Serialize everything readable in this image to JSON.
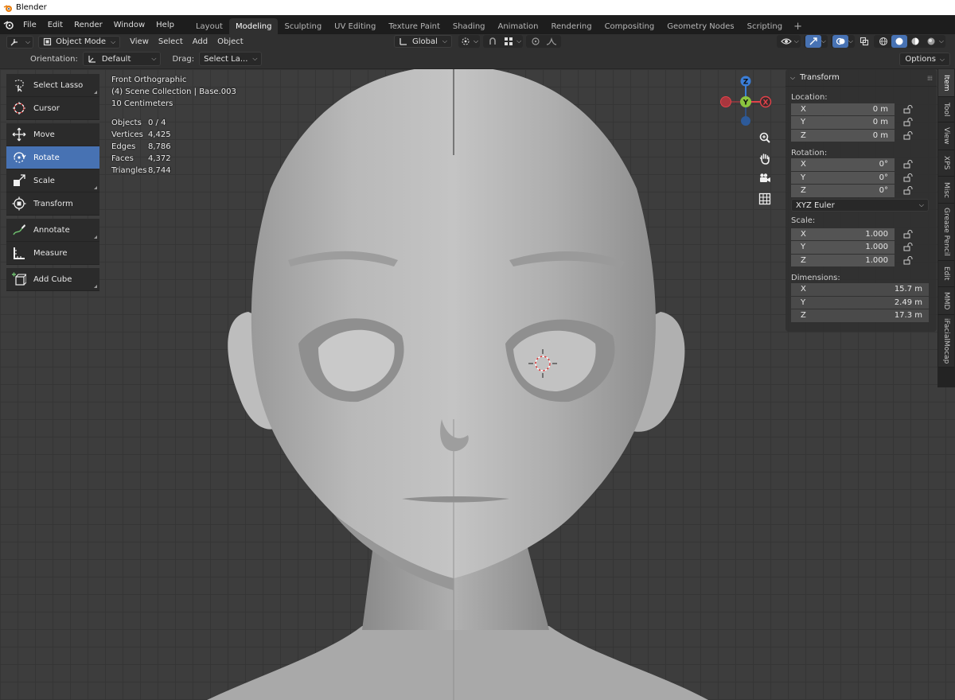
{
  "window": {
    "title": "Blender"
  },
  "menu": [
    "File",
    "Edit",
    "Render",
    "Window",
    "Help"
  ],
  "workspaces": [
    "Layout",
    "Modeling",
    "Sculpting",
    "UV Editing",
    "Texture Paint",
    "Shading",
    "Animation",
    "Rendering",
    "Compositing",
    "Geometry Nodes",
    "Scripting"
  ],
  "active_workspace": "Modeling",
  "header": {
    "mode": "Object Mode",
    "menus": [
      "View",
      "Select",
      "Add",
      "Object"
    ],
    "transform_orientation": "Global"
  },
  "tool_settings": {
    "orientation_label": "Orientation:",
    "orientation_value": "Default",
    "drag_label": "Drag:",
    "drag_value": "Select La...",
    "options_label": "Options"
  },
  "tools": {
    "select_lasso": "Select Lasso",
    "cursor": "Cursor",
    "move": "Move",
    "rotate": "Rotate",
    "scale": "Scale",
    "transform": "Transform",
    "annotate": "Annotate",
    "measure": "Measure",
    "add_cube": "Add Cube"
  },
  "overlay": {
    "view": "Front Orthographic",
    "collection": "(4) Scene Collection | Base.003",
    "scale": "10 Centimeters",
    "stats": [
      {
        "label": "Objects",
        "value": "0 / 4"
      },
      {
        "label": "Vertices",
        "value": "4,425"
      },
      {
        "label": "Edges",
        "value": "8,786"
      },
      {
        "label": "Faces",
        "value": "4,372"
      },
      {
        "label": "Triangles",
        "value": "8,744"
      }
    ]
  },
  "gizmo": {
    "x": "X",
    "y": "Y",
    "z": "Z"
  },
  "npanel": {
    "title": "Transform",
    "location_label": "Location:",
    "location": [
      {
        "axis": "X",
        "value": "0 m"
      },
      {
        "axis": "Y",
        "value": "0 m"
      },
      {
        "axis": "Z",
        "value": "0 m"
      }
    ],
    "rotation_label": "Rotation:",
    "rotation": [
      {
        "axis": "X",
        "value": "0°"
      },
      {
        "axis": "Y",
        "value": "0°"
      },
      {
        "axis": "Z",
        "value": "0°"
      }
    ],
    "rotation_mode": "XYZ Euler",
    "scale_label": "Scale:",
    "scale": [
      {
        "axis": "X",
        "value": "1.000"
      },
      {
        "axis": "Y",
        "value": "1.000"
      },
      {
        "axis": "Z",
        "value": "1.000"
      }
    ],
    "dimensions_label": "Dimensions:",
    "dimensions": [
      {
        "axis": "X",
        "value": "15.7 m"
      },
      {
        "axis": "Y",
        "value": "2.49 m"
      },
      {
        "axis": "Z",
        "value": "17.3 m"
      }
    ]
  },
  "sidebar_tabs": [
    "Item",
    "Tool",
    "View",
    "XPS",
    "Misc",
    "Grease Pencil",
    "Edit",
    "MMD",
    "iFacialMocap"
  ],
  "colors": {
    "accent": "#4772b3",
    "x_axis": "#e3424a",
    "y_axis": "#8bc53f",
    "z_axis": "#3b7ed8"
  }
}
